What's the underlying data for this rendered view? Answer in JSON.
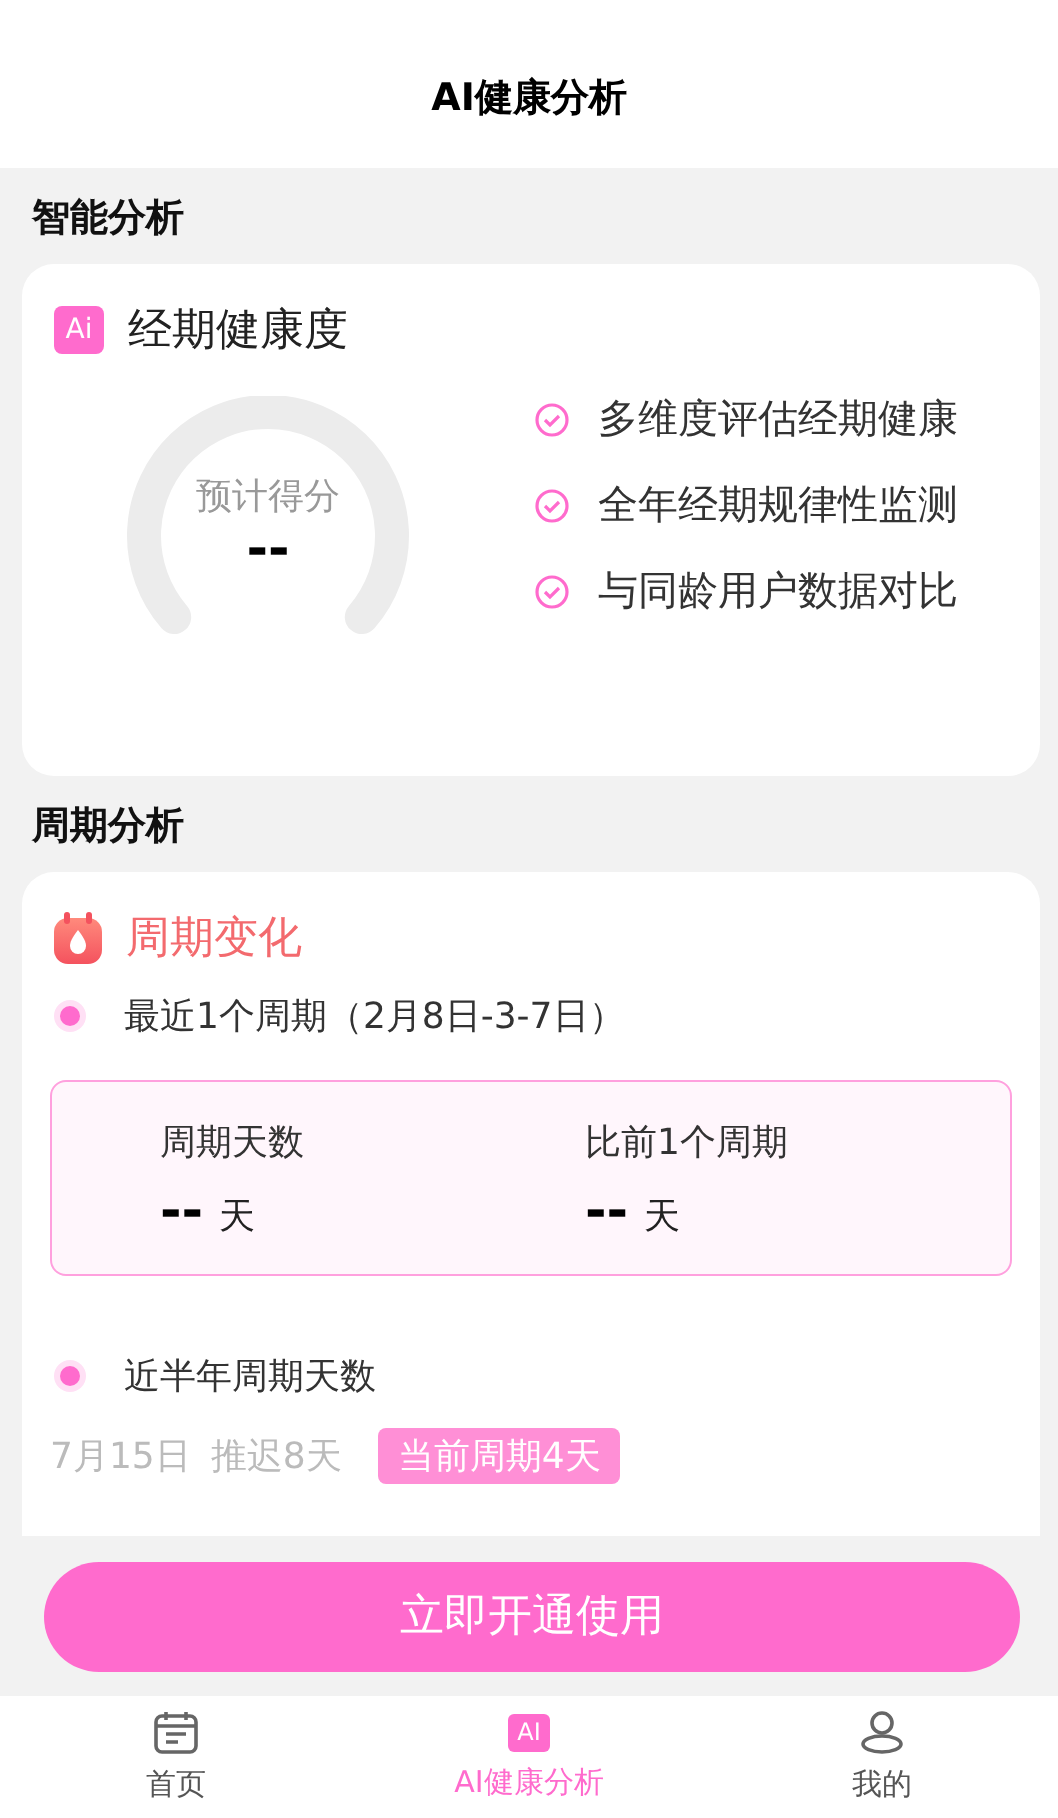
{
  "header": {
    "title": "AI健康分析"
  },
  "sections": [
    {
      "label": "智能分析"
    },
    {
      "label": "周期分析"
    }
  ],
  "health_card": {
    "badge": "Ai",
    "title": "经期健康度",
    "gauge": {
      "caption": "预计得分",
      "score": "--"
    },
    "features": [
      "多维度评估经期健康",
      "全年经期规律性监测",
      "与同龄用户数据对比"
    ]
  },
  "cycle_card": {
    "title": "周期变化",
    "recent": {
      "label": "最近1个周期（2月8日-3-7日）"
    },
    "stats": [
      {
        "label": "周期天数",
        "value": "--",
        "unit": "天"
      },
      {
        "label": "比前1个周期",
        "value": "--",
        "unit": "天"
      }
    ],
    "half_year": {
      "label": "近半年周期天数"
    },
    "history": [
      {
        "date": "7月15日",
        "note": "推迟8天",
        "tag": "当前周期4天"
      }
    ]
  },
  "cta": {
    "label": "立即开通使用"
  },
  "tabbar": [
    {
      "kind": "calendar",
      "label": "首页",
      "selected": false
    },
    {
      "kind": "ai",
      "badge": "AI",
      "label": "AI健康分析",
      "selected": true
    },
    {
      "kind": "person",
      "label": "我的",
      "selected": false
    }
  ]
}
